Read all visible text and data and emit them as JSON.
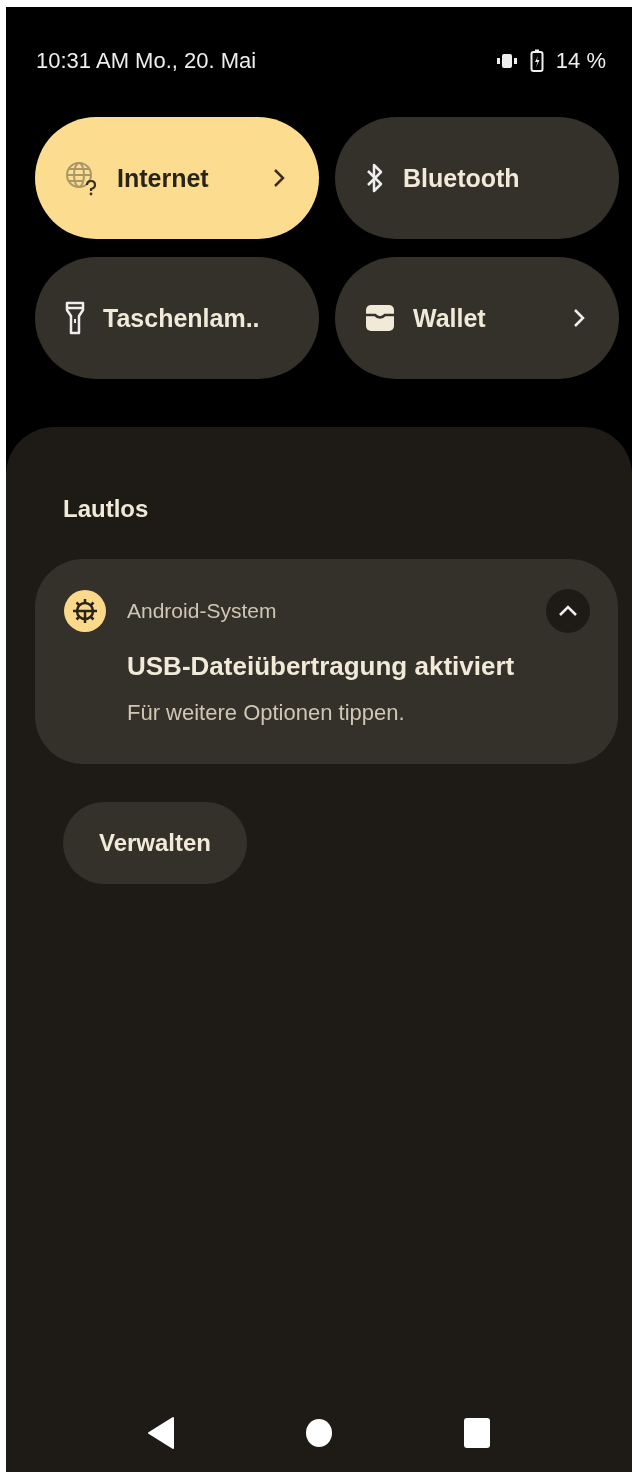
{
  "status_bar": {
    "time_date": "10:31 AM Mo., 20. Mai",
    "battery": "14 %"
  },
  "tiles": [
    {
      "kind": "internet",
      "label": "Internet",
      "on": true,
      "chevron": true
    },
    {
      "kind": "bluetooth",
      "label": "Bluetooth",
      "on": false,
      "chevron": false
    },
    {
      "kind": "flashlight",
      "label": "Taschenlam..",
      "on": false,
      "chevron": false
    },
    {
      "kind": "wallet",
      "label": "Wallet",
      "on": false,
      "chevron": true
    }
  ],
  "section_title": "Lautlos",
  "notification": {
    "app": "Android-System",
    "title": "USB-Dateiübertragung aktiviert",
    "text": "Für weitere Optionen tippen.",
    "expanded": true
  },
  "manage_button": "Verwalten"
}
